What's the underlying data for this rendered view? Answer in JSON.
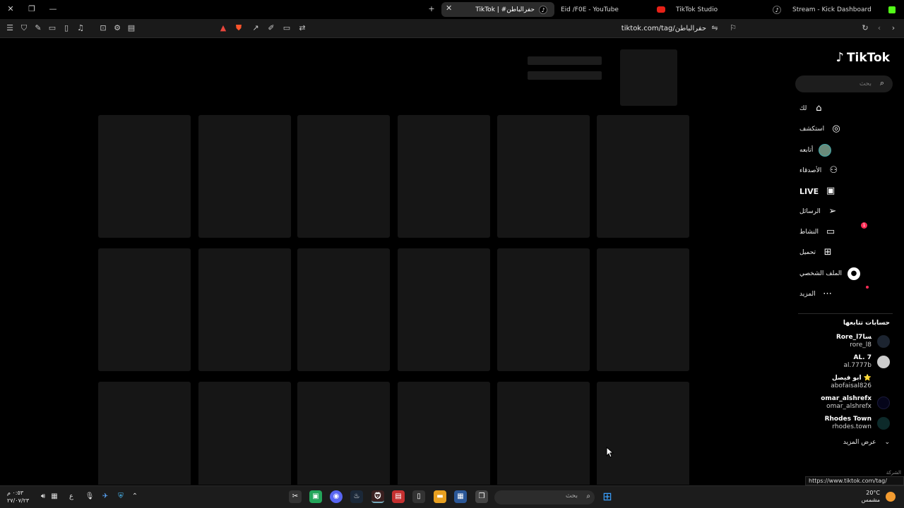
{
  "tabs": [
    {
      "title": "TikTok | #حفرالباطن",
      "active": true
    },
    {
      "title": "Eid /F0E - YouTube",
      "active": false
    },
    {
      "title": "TikTok Studio",
      "active": false
    },
    {
      "title": "Stream - Kick Dashboard",
      "active": false
    }
  ],
  "toolbar": {
    "url": "tiktok.com/tag/حفرالباطن"
  },
  "sidebar": {
    "logo": "TikTok",
    "search_placeholder": "بحث",
    "nav": [
      {
        "label": "لك",
        "icon": "home-icon"
      },
      {
        "label": "استكشف",
        "icon": "compass-icon"
      },
      {
        "label": "أتابعه",
        "icon": "following-avatar-icon"
      },
      {
        "label": "الأصدقاء",
        "icon": "friends-icon"
      },
      {
        "label": "LIVE",
        "icon": "live-icon"
      },
      {
        "label": "الرسائل",
        "icon": "messages-icon"
      },
      {
        "label": "النشاط",
        "icon": "activity-icon",
        "badge": "1"
      },
      {
        "label": "تحميل",
        "icon": "upload-icon"
      },
      {
        "label": "الملف الشخصي",
        "icon": "profile-icon"
      },
      {
        "label": "المزيد",
        "icon": "more-icon"
      }
    ],
    "following_heading": "حسابات تتابعها",
    "accounts": [
      {
        "display": "Rore_l7ﺴﺎ",
        "user": "rore_l8"
      },
      {
        "display": "AL. 7",
        "user": "al.7777b"
      },
      {
        "display": "ابو فيصل ⭐",
        "user": "abofaisal826"
      },
      {
        "display": "omar_alshrefx",
        "user": "omar_alshrefx"
      },
      {
        "display": "Rhodes Town",
        "user": "rhodes.town"
      }
    ],
    "see_more": "عرض المزيد",
    "company": "الشركة"
  },
  "status_url": "https://www.tiktok.com/tag/حفرالباطن",
  "taskbar": {
    "time": "٠:٥٣ م",
    "date": "٢٧/٠٧/٢٣",
    "search_placeholder": "بحث",
    "weather_temp": "20°C",
    "weather_desc": "مشمس"
  }
}
